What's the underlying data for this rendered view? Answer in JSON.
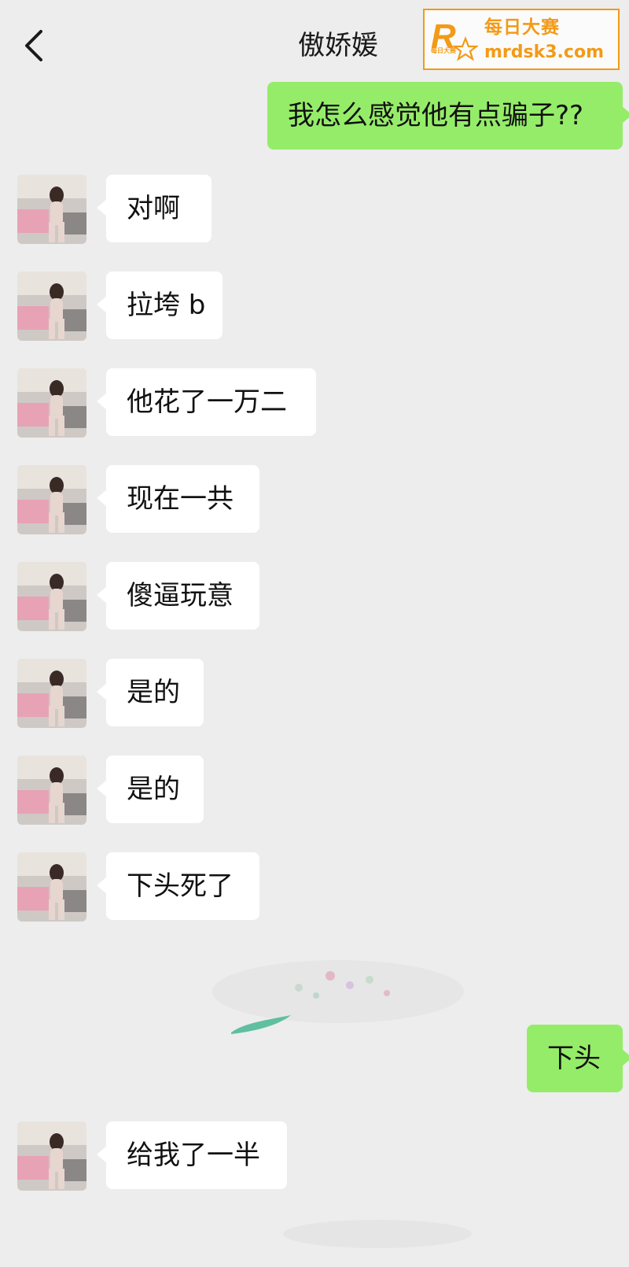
{
  "header": {
    "title": "傲娇媛",
    "back_icon": "chevron-left-icon"
  },
  "watermark": {
    "logo_letter": "R",
    "logo_sub": "每日大赛",
    "line1": "每日大赛",
    "line2": "mrdsk3.com",
    "color": "#f39a16"
  },
  "colors": {
    "background": "#ededed",
    "outgoing_bubble": "#95ec69",
    "incoming_bubble": "#ffffff"
  },
  "messages": [
    {
      "side": "out",
      "text": "我怎么感觉他有点骗子??"
    },
    {
      "side": "in",
      "text": "对啊"
    },
    {
      "side": "in",
      "text": "拉垮 b"
    },
    {
      "side": "in",
      "text": "他花了一万二"
    },
    {
      "side": "in",
      "text": "现在一共"
    },
    {
      "side": "in",
      "text": "傻逼玩意"
    },
    {
      "side": "in",
      "text": "是的"
    },
    {
      "side": "in",
      "text": "是的"
    },
    {
      "side": "in",
      "text": "下头死了"
    },
    {
      "side": "out",
      "text": "下头"
    },
    {
      "side": "in",
      "text": "给我了一半"
    }
  ]
}
